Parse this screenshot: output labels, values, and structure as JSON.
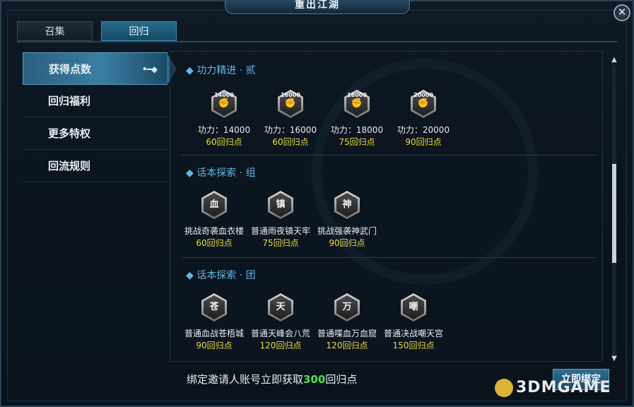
{
  "window": {
    "title": "重出江湖",
    "close_icon": "✕"
  },
  "tabs": [
    {
      "label": "召集",
      "active": false
    },
    {
      "label": "回归",
      "active": true
    }
  ],
  "sidebar": {
    "items": [
      {
        "label": "获得点数",
        "active": true,
        "arrow": "•━◆"
      },
      {
        "label": "回归福利",
        "active": false
      },
      {
        "label": "更多特权",
        "active": false
      },
      {
        "label": "回流规则",
        "active": false
      }
    ]
  },
  "sections": [
    {
      "title": "功力精进 · 贰",
      "items": [
        {
          "badge": "14000",
          "icon": "fist-icon",
          "name": "功力：14000",
          "points": "60回归点"
        },
        {
          "badge": "16000",
          "icon": "fist-icon",
          "name": "功力：16000",
          "points": "60回归点"
        },
        {
          "badge": "18000",
          "icon": "fist-icon",
          "name": "功力：18000",
          "points": "75回归点"
        },
        {
          "badge": "20000",
          "icon": "fist-icon",
          "name": "功力：20000",
          "points": "90回归点"
        }
      ]
    },
    {
      "title": "话本探索 · 组",
      "items": [
        {
          "badge": "血",
          "icon": "pagoda-icon",
          "name": "挑战奇袭血衣楼",
          "points": "60回归点"
        },
        {
          "badge": "镇",
          "icon": "pagoda-icon",
          "name": "普通雨夜镇天牢",
          "points": "75回归点"
        },
        {
          "badge": "神",
          "icon": "pagoda-icon",
          "name": "挑战强袭神武门",
          "points": "90回归点"
        }
      ]
    },
    {
      "title": "话本探索 · 团",
      "items": [
        {
          "badge": "苍",
          "icon": "pagoda-icon",
          "name": "普通血战苍梧城",
          "points": "90回归点"
        },
        {
          "badge": "天",
          "icon": "pagoda-icon",
          "name": "普通天峰会八荒",
          "points": "120回归点"
        },
        {
          "badge": "万",
          "icon": "pagoda-icon",
          "name": "普通喋血万血窟",
          "points": "120回归点"
        },
        {
          "badge": "嘲",
          "icon": "pagoda-icon",
          "name": "普通决战嘲天宫",
          "points": "150回归点"
        }
      ]
    }
  ],
  "section_marker": "◆",
  "footer": {
    "text_before": "绑定邀请人账号立即获取",
    "highlight": "300",
    "text_after": "回归点",
    "bind_button": "立即绑定"
  },
  "scrollbar": {
    "up": "▲",
    "down": "▼"
  },
  "watermark": "3DMGAME"
}
